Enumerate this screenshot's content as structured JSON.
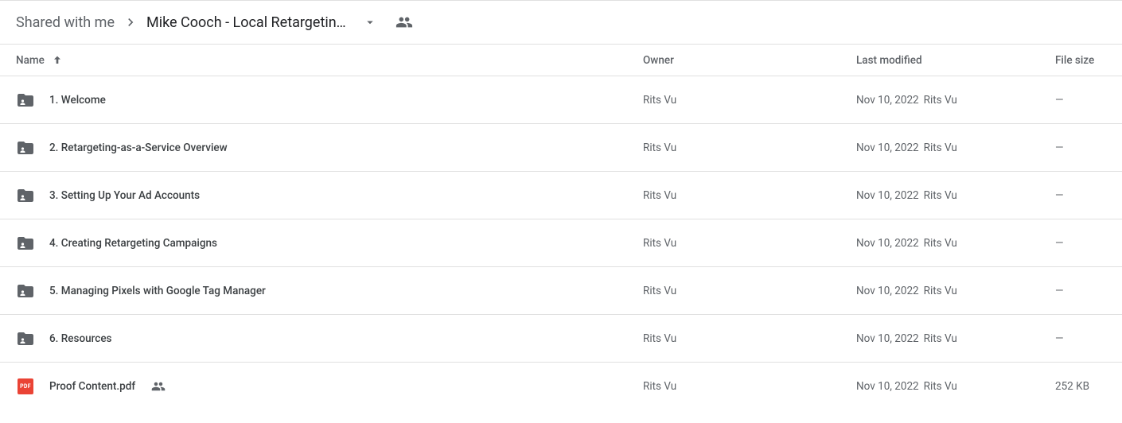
{
  "breadcrumb": {
    "root": "Shared with me",
    "current": "Mike Cooch - Local Retargetin…"
  },
  "columns": {
    "name": "Name",
    "owner": "Owner",
    "modified": "Last modified",
    "size": "File size"
  },
  "rows": [
    {
      "type": "folder",
      "name": "1. Welcome",
      "owner": "Rits Vu",
      "modified": "Nov 10, 2022",
      "modifiedBy": "Rits Vu",
      "size": "—",
      "shared": false
    },
    {
      "type": "folder",
      "name": "2. Retargeting-as-a-Service Overview",
      "owner": "Rits Vu",
      "modified": "Nov 10, 2022",
      "modifiedBy": "Rits Vu",
      "size": "—",
      "shared": false
    },
    {
      "type": "folder",
      "name": "3. Setting Up Your Ad Accounts",
      "owner": "Rits Vu",
      "modified": "Nov 10, 2022",
      "modifiedBy": "Rits Vu",
      "size": "—",
      "shared": false
    },
    {
      "type": "folder",
      "name": "4. Creating Retargeting Campaigns",
      "owner": "Rits Vu",
      "modified": "Nov 10, 2022",
      "modifiedBy": "Rits Vu",
      "size": "—",
      "shared": false
    },
    {
      "type": "folder",
      "name": "5. Managing Pixels with Google Tag Manager",
      "owner": "Rits Vu",
      "modified": "Nov 10, 2022",
      "modifiedBy": "Rits Vu",
      "size": "—",
      "shared": false
    },
    {
      "type": "folder",
      "name": "6. Resources",
      "owner": "Rits Vu",
      "modified": "Nov 10, 2022",
      "modifiedBy": "Rits Vu",
      "size": "—",
      "shared": false
    },
    {
      "type": "pdf",
      "name": "Proof Content.pdf",
      "owner": "Rits Vu",
      "modified": "Nov 10, 2022",
      "modifiedBy": "Rits Vu",
      "size": "252 KB",
      "shared": true
    }
  ],
  "icons": {
    "pdf_label": "PDF"
  }
}
